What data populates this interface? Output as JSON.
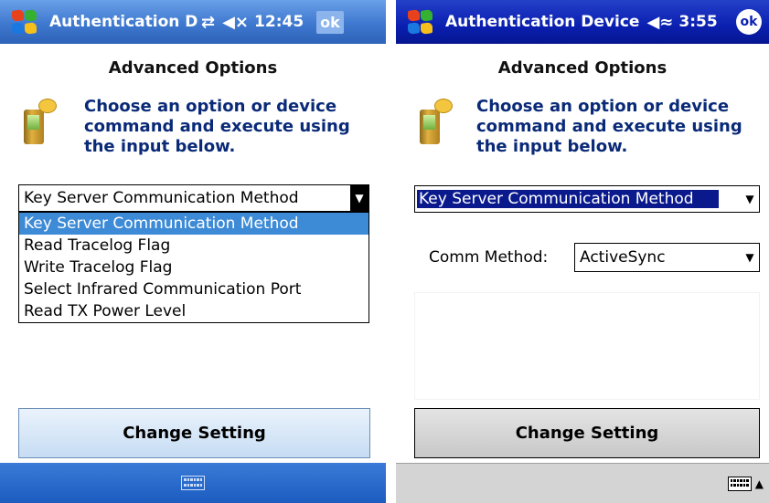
{
  "left": {
    "title": "Authentication De",
    "clock": "12:45",
    "ok": "ok",
    "heading": "Advanced Options",
    "instructions": [
      "Choose an option or device",
      "command and execute using",
      "the input below."
    ],
    "combo_value": "Key Server Communication Method",
    "dropdown_items": [
      "Key Server Communication Method",
      "Read Tracelog Flag",
      "Write Tracelog Flag",
      "Select Infrared Communication Port",
      "Read TX Power Level"
    ],
    "button": "Change Setting",
    "icons": [
      "windows-start-icon",
      "sync-icon",
      "volume-icon",
      "keyboard-icon"
    ]
  },
  "right": {
    "title": "Authentication Device",
    "clock": "3:55",
    "ok": "ok",
    "heading": "Advanced Options",
    "instructions": [
      "Choose an option or device",
      "command and execute using",
      "the input below."
    ],
    "combo_value": "Key Server Communication Method",
    "comm_label": "Comm Method:",
    "comm_value": "ActiveSync",
    "button": "Change Setting",
    "icons": [
      "windows-start-icon",
      "volume-icon",
      "keyboard-icon",
      "sip-arrow-icon"
    ]
  },
  "colors": {
    "left_titlebar": "#3e78cf",
    "right_titlebar": "#0a1fb0",
    "selected_item": "#3d8ad6",
    "instruction_text": "#0a2a78"
  }
}
